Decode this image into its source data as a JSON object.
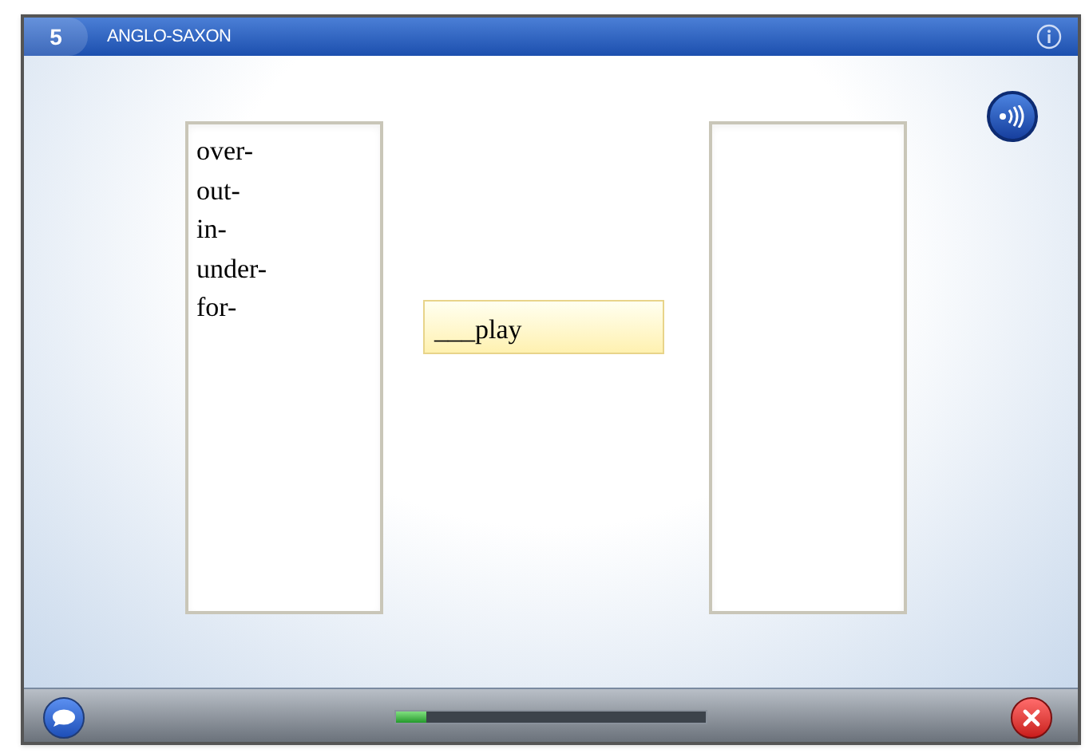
{
  "header": {
    "number": "5",
    "title": "ANGLO-SAXON"
  },
  "word_bank": [
    "over-",
    "out-",
    "in-",
    "under-",
    "for-"
  ],
  "prompt": "___play",
  "footer": {
    "progress": {
      "level": 0.1
    }
  }
}
